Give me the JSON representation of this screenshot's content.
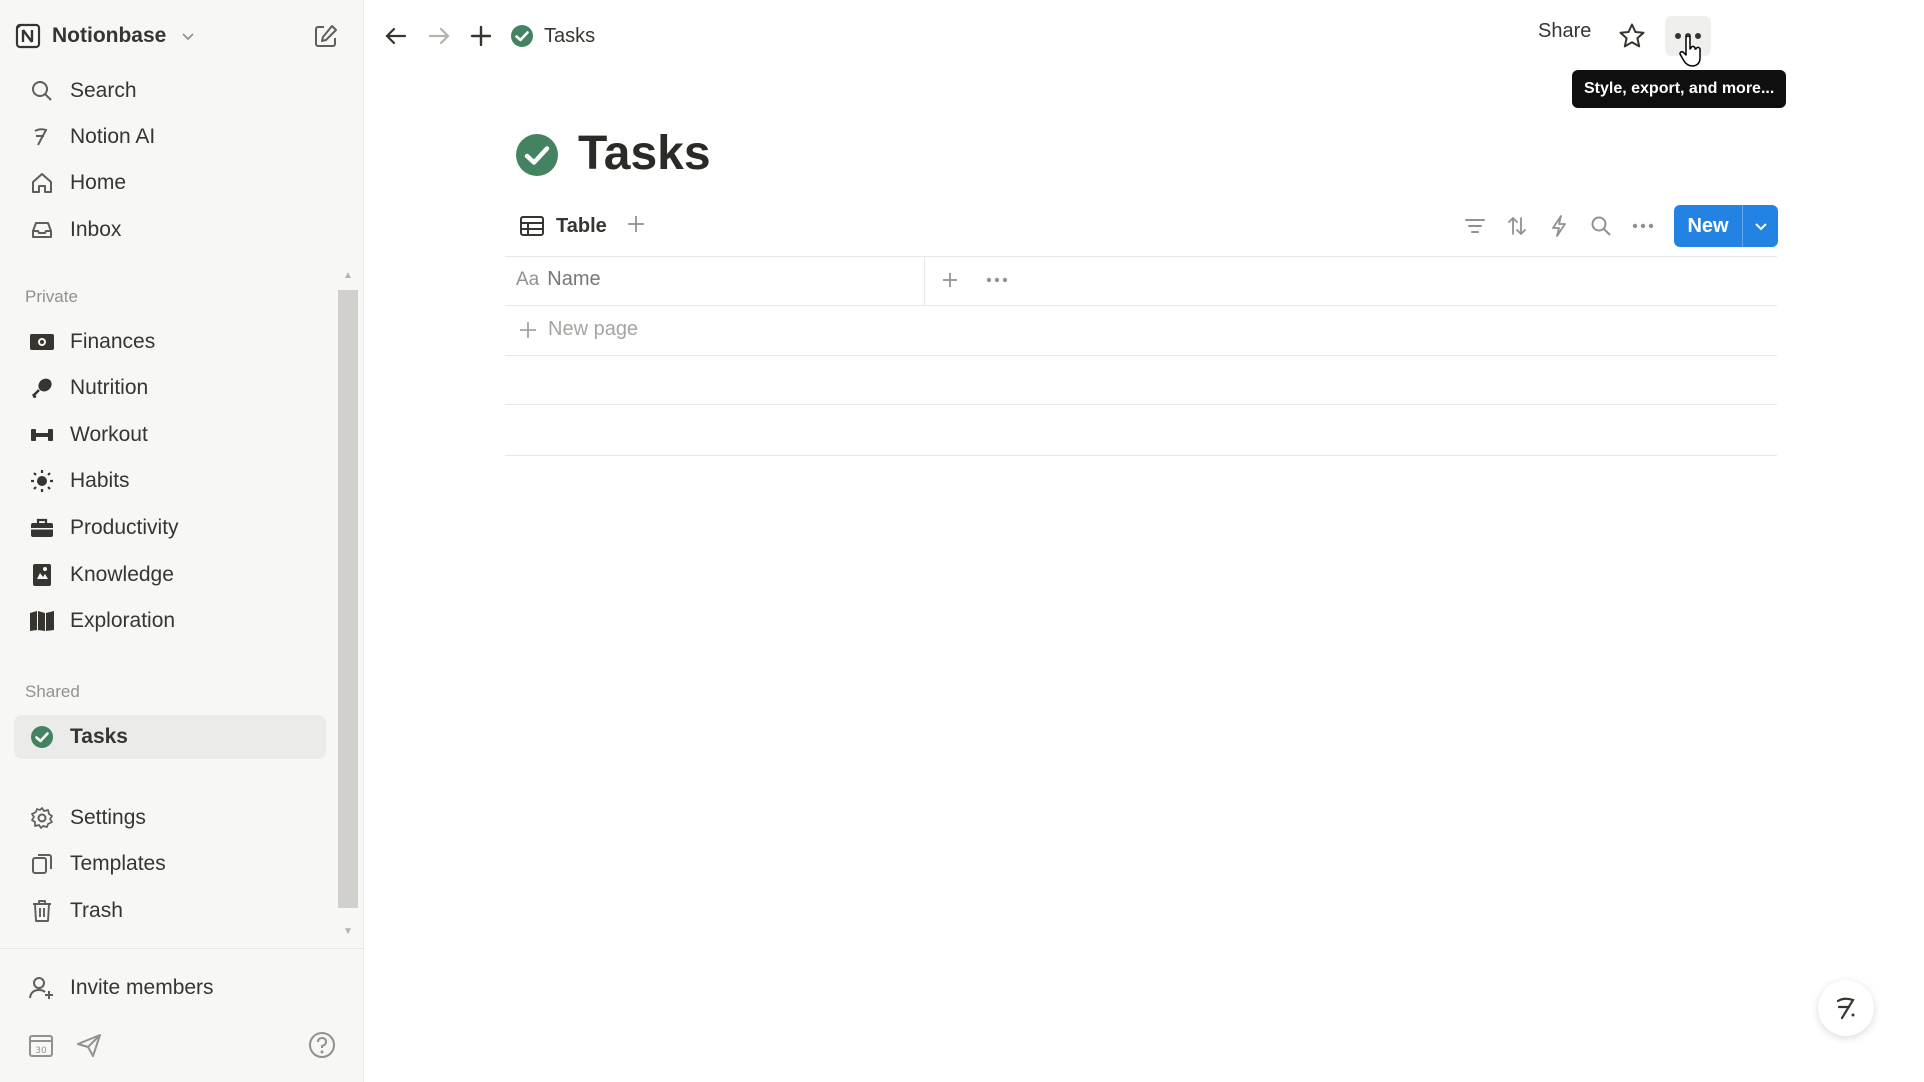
{
  "workspace": {
    "name": "Notionbase"
  },
  "sidebar": {
    "top_items": [
      {
        "label": "Search",
        "icon": "search-icon"
      },
      {
        "label": "Notion AI",
        "icon": "notion-ai-icon"
      },
      {
        "label": "Home",
        "icon": "home-icon"
      },
      {
        "label": "Inbox",
        "icon": "inbox-icon"
      }
    ],
    "private_label": "Private",
    "private_items": [
      {
        "label": "Finances",
        "icon": "money-icon"
      },
      {
        "label": "Nutrition",
        "icon": "drumstick-icon"
      },
      {
        "label": "Workout",
        "icon": "dumbbell-icon"
      },
      {
        "label": "Habits",
        "icon": "sun-icon"
      },
      {
        "label": "Productivity",
        "icon": "briefcase-icon"
      },
      {
        "label": "Knowledge",
        "icon": "notebook-icon"
      },
      {
        "label": "Exploration",
        "icon": "map-icon"
      }
    ],
    "shared_label": "Shared",
    "shared_items": [
      {
        "label": "Tasks",
        "icon": "check-circle-icon",
        "active": true
      }
    ],
    "utility_items": [
      {
        "label": "Settings",
        "icon": "gear-icon"
      },
      {
        "label": "Templates",
        "icon": "templates-icon"
      },
      {
        "label": "Trash",
        "icon": "trash-icon"
      }
    ],
    "invite_label": "Invite members"
  },
  "topbar": {
    "breadcrumb": "Tasks",
    "share_label": "Share",
    "tooltip": "Style, export, and more..."
  },
  "page": {
    "title": "Tasks",
    "view_tab_label": "Table",
    "new_button_label": "New",
    "columns": [
      {
        "prefix": "Aa",
        "label": "Name"
      }
    ],
    "new_row_label": "New page"
  },
  "colors": {
    "accent": "#2383e2",
    "check_green": "#448361",
    "sidebar_bg": "#f7f7f5"
  }
}
